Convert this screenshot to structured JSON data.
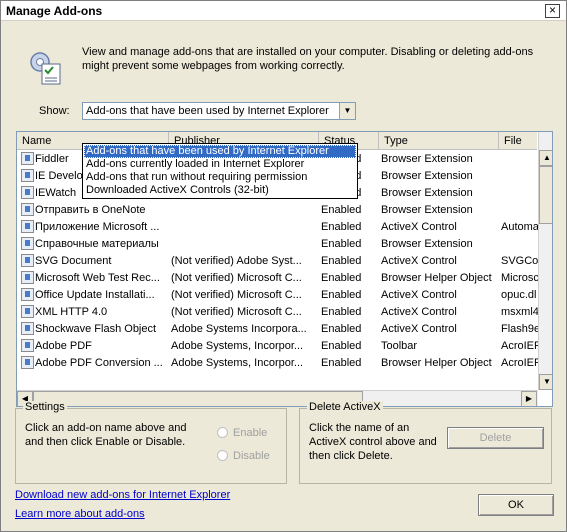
{
  "window": {
    "title": "Manage Add-ons",
    "close_glyph": "×"
  },
  "header": {
    "description": "View and manage add-ons that are installed on your computer. Disabling or deleting add-ons might prevent some webpages from working correctly."
  },
  "show": {
    "label": "Show:",
    "selected": "Add-ons that have been used by Internet Explorer",
    "options": [
      "Add-ons that have been used by Internet Explorer",
      "Add-ons currently loaded in Internet Explorer",
      "Add-ons that run without requiring permission",
      "Downloaded ActiveX Controls (32-bit)"
    ]
  },
  "list": {
    "columns": [
      "Name",
      "Publisher",
      "Status",
      "Type",
      "File"
    ],
    "rows": [
      {
        "name": "Fiddler",
        "publisher": "",
        "status": "Enabled",
        "type": "Browser Extension",
        "file": ""
      },
      {
        "name": "IE Developer Toolbar",
        "publisher": "",
        "status": "Enabled",
        "type": "Browser Extension",
        "file": ""
      },
      {
        "name": "IEWatch",
        "publisher": "",
        "status": "Enabled",
        "type": "Browser Extension",
        "file": ""
      },
      {
        "name": "Отправить в OneNote",
        "publisher": "",
        "status": "Enabled",
        "type": "Browser Extension",
        "file": ""
      },
      {
        "name": "Приложение Microsoft ...",
        "publisher": "",
        "status": "Enabled",
        "type": "ActiveX Control",
        "file": "Automa"
      },
      {
        "name": "Справочные материалы",
        "publisher": "",
        "status": "Enabled",
        "type": "Browser Extension",
        "file": ""
      },
      {
        "name": "SVG Document",
        "publisher": "(Not verified) Adobe Syst...",
        "status": "Enabled",
        "type": "ActiveX Control",
        "file": "SVGCor"
      },
      {
        "name": "Microsoft Web Test Rec...",
        "publisher": "(Not verified) Microsoft C...",
        "status": "Enabled",
        "type": "Browser Helper Object",
        "file": "Microsc"
      },
      {
        "name": "Office Update Installati...",
        "publisher": "(Not verified) Microsoft C...",
        "status": "Enabled",
        "type": "ActiveX Control",
        "file": "opuc.dl"
      },
      {
        "name": "XML HTTP 4.0",
        "publisher": "(Not verified) Microsoft C...",
        "status": "Enabled",
        "type": "ActiveX Control",
        "file": "msxml4"
      },
      {
        "name": "Shockwave Flash Object",
        "publisher": "Adobe Systems Incorpora...",
        "status": "Enabled",
        "type": "ActiveX Control",
        "file": "Flash9e"
      },
      {
        "name": "Adobe PDF",
        "publisher": "Adobe Systems, Incorpor...",
        "status": "Enabled",
        "type": "Toolbar",
        "file": "AcroIEF"
      },
      {
        "name": "Adobe PDF Conversion ...",
        "publisher": "Adobe Systems, Incorpor...",
        "status": "Enabled",
        "type": "Browser Helper Object",
        "file": "AcroIEF"
      }
    ]
  },
  "settings": {
    "title": "Settings",
    "text": "Click an add-on name above and and then click Enable or Disable.",
    "enable_label": "Enable",
    "disable_label": "Disable"
  },
  "delete_activex": {
    "title": "Delete ActiveX",
    "text": "Click the name of an ActiveX control above and then click Delete.",
    "delete_label": "Delete"
  },
  "footer": {
    "download_link": "Download new add-ons for Internet Explorer",
    "learn_link": "Learn more about add-ons",
    "ok_label": "OK"
  }
}
